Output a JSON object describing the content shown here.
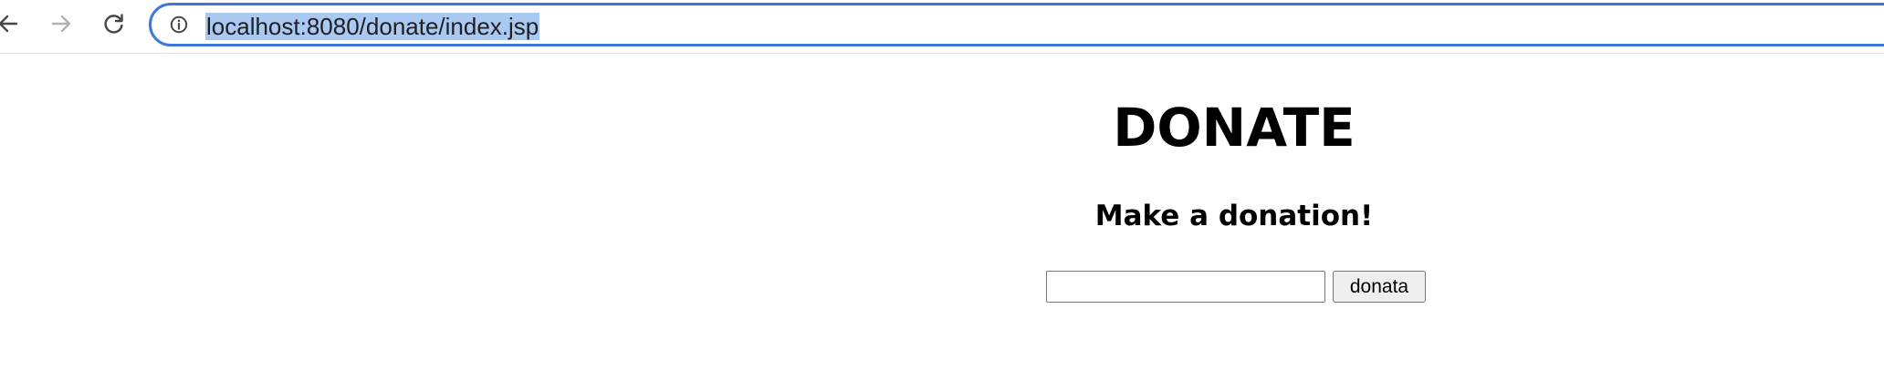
{
  "browser": {
    "url": "localhost:8080/donate/index.jsp",
    "back_icon": "arrow-left-icon",
    "forward_icon": "arrow-right-icon",
    "reload_icon": "reload-icon",
    "site_info_icon": "info-icon",
    "accent_color": "#3c78d8",
    "selection_color": "#a9c8f2"
  },
  "page": {
    "title": "DONATE",
    "subtitle": "Make a donation!",
    "input_value": "",
    "button_label": "donata"
  }
}
